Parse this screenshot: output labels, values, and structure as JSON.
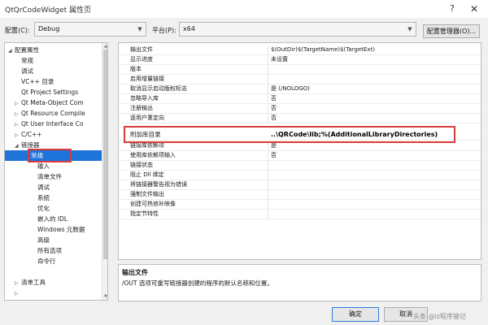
{
  "window": {
    "title": "QtQrCodeWidget 属性页",
    "help": "?",
    "close": "✕"
  },
  "config": {
    "config_label": "配置(C):",
    "config_value": "Debug",
    "platform_label": "平台(P):",
    "platform_value": "x64",
    "manager_label": "配置管理器(O)..."
  },
  "tree": [
    {
      "label": "配置属性",
      "expander": "◢"
    },
    {
      "label": "常规",
      "expander": ""
    },
    {
      "label": "调试",
      "expander": ""
    },
    {
      "label": "VC++ 目录",
      "expander": ""
    },
    {
      "label": "Qt Project Settings",
      "expander": ""
    },
    {
      "label": "Qt Meta-Object Com",
      "expander": "▷"
    },
    {
      "label": "Qt Resource Compile",
      "expander": "▷"
    },
    {
      "label": "Qt User Interface Co",
      "expander": "▷"
    },
    {
      "label": "C/C++",
      "expander": "▷"
    },
    {
      "label": "链接器",
      "expander": "◢"
    },
    {
      "label": "常规",
      "expander": ""
    },
    {
      "label": "输入",
      "expander": ""
    },
    {
      "label": "清单文件",
      "expander": ""
    },
    {
      "label": "调试",
      "expander": ""
    },
    {
      "label": "系统",
      "expander": ""
    },
    {
      "label": "优化",
      "expander": ""
    },
    {
      "label": "嵌入的 IDL",
      "expander": ""
    },
    {
      "label": "Windows 元数据",
      "expander": ""
    },
    {
      "label": "高级",
      "expander": ""
    },
    {
      "label": "所有选项",
      "expander": ""
    },
    {
      "label": "命令行",
      "expander": ""
    },
    {
      "label": "清单工具",
      "expander": "▷"
    },
    {
      "label": "",
      "expander": ""
    }
  ],
  "properties": [
    {
      "name": "输出文件",
      "value": "$(OutDir)$(TargetName)$(TargetExt)"
    },
    {
      "name": "显示进度",
      "value": "未设置"
    },
    {
      "name": "版本",
      "value": ""
    },
    {
      "name": "启用增量链接",
      "value": ""
    },
    {
      "name": "取消显示启动版权标志",
      "value": "是 (/NOLOGO)"
    },
    {
      "name": "忽略导入库",
      "value": "否"
    },
    {
      "name": "注册输出",
      "value": "否"
    },
    {
      "name": "逐用户重定向",
      "value": "否"
    },
    {
      "name": "附加库目录",
      "value": "..\\QRCode\\lib;%(AdditionalLibraryDirectories)"
    },
    {
      "name": "链接库依赖项",
      "value": "是"
    },
    {
      "name": "使用库依赖项输入",
      "value": "否"
    },
    {
      "name": "链接状态",
      "value": ""
    },
    {
      "name": "阻止 Dll 绑定",
      "value": ""
    },
    {
      "name": "将链接器警告视为错误",
      "value": ""
    },
    {
      "name": "强制文件输出",
      "value": ""
    },
    {
      "name": "创建可热修补映像",
      "value": ""
    },
    {
      "name": "指定节特性",
      "value": ""
    }
  ],
  "description": {
    "title": "输出文件",
    "text": "/OUT 选项可重写链接器创建的程序的默认名称和位置。"
  },
  "buttons": {
    "ok": "确定",
    "cancel": "取消"
  },
  "watermark": "头条 @lz程序猿记",
  "colors": {
    "selection": "#1e73d8",
    "highlight_border": "#d93b3b"
  }
}
